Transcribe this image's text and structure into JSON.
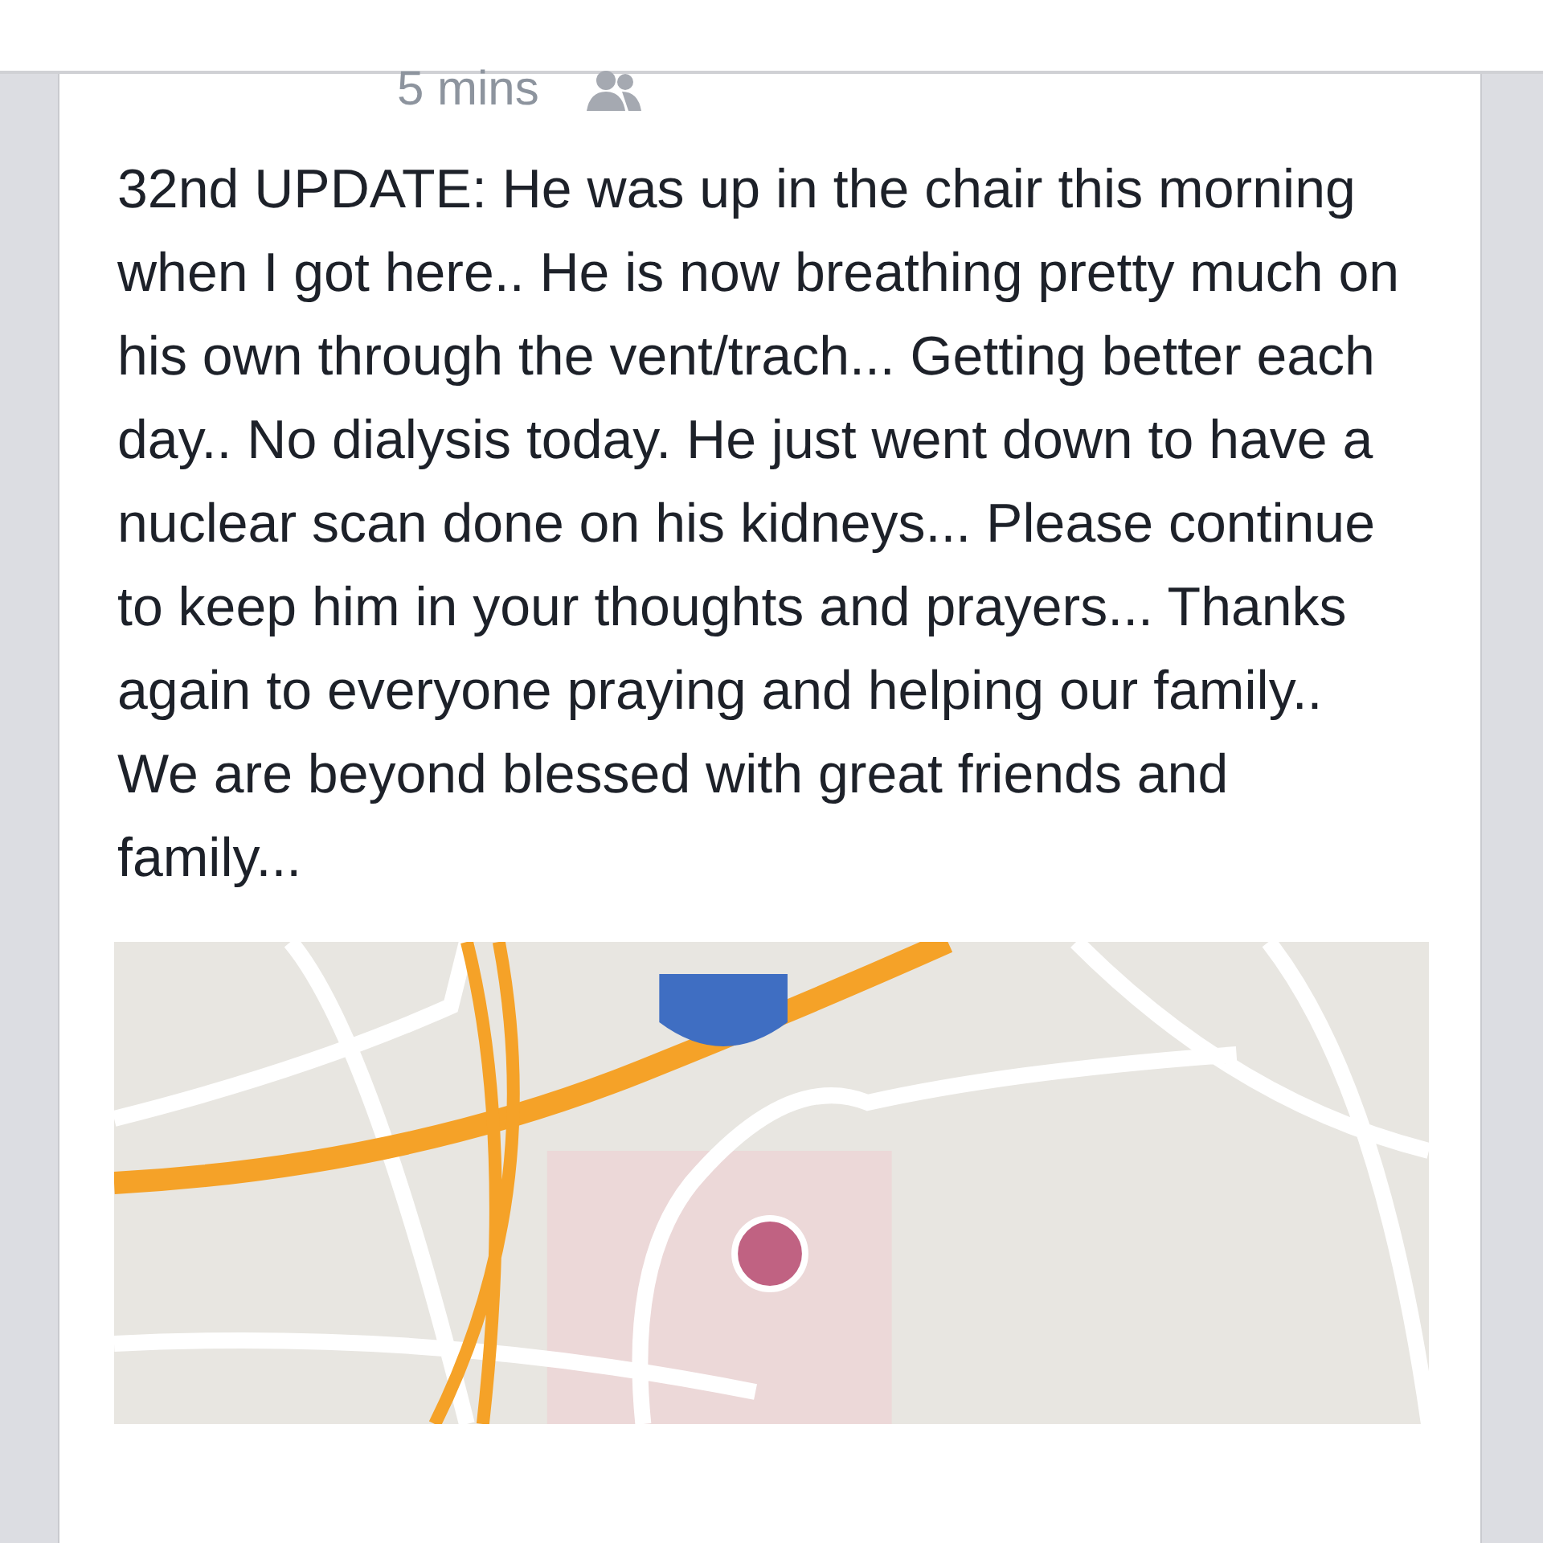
{
  "post": {
    "time": "5 mins",
    "text": "32nd UPDATE:  He was up in the chair this morning when I got here.. He is now breathing pretty much on his own through the vent/trach... Getting better each day.. No dialysis today. He just went down to have a nuclear scan done on his kidneys... Please continue to keep him in your thoughts and prayers... Thanks again to everyone praying and helping our family.. We are beyond blessed with great friends and family..."
  }
}
